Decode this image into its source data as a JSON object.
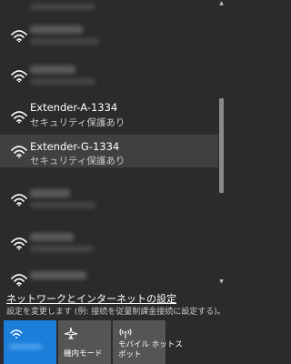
{
  "networks": [
    {
      "ssid": "",
      "status": ""
    },
    {
      "ssid": "",
      "status": ""
    },
    {
      "ssid": "",
      "status": ""
    },
    {
      "ssid": "Extender-A-1334",
      "status": "セキュリティ保護あり"
    },
    {
      "ssid": "Extender-G-1334",
      "status": "セキュリティ保護あり"
    },
    {
      "ssid": "",
      "status": ""
    },
    {
      "ssid": "",
      "status": ""
    },
    {
      "ssid": "",
      "status": ""
    }
  ],
  "settings": {
    "link": "ネットワークとインターネットの設定",
    "description": "設定を変更します (例: 接続を従量制課金接続に設定する)。"
  },
  "quick_actions": [
    {
      "label": "",
      "icon": "wifi-icon",
      "active": true
    },
    {
      "label": "機内モード",
      "icon": "airplane-icon",
      "active": false
    },
    {
      "label_line1": "モバイル ホットス",
      "label_line2": "ポット",
      "icon": "hotspot-icon",
      "active": false
    }
  ],
  "colors": {
    "background": "#2b2b2b",
    "hover": "#404040",
    "accent": "#1b7ed9",
    "tile": "#555555"
  }
}
